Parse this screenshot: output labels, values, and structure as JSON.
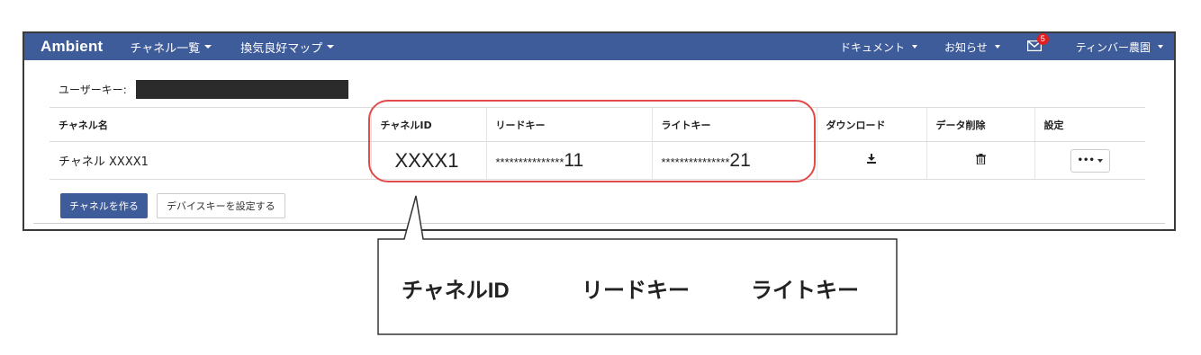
{
  "navbar": {
    "brand": "Ambient",
    "menu": [
      {
        "label": "チャネル一覧"
      },
      {
        "label": "換気良好マップ"
      }
    ],
    "documents": "ドキュメント",
    "notices": "お知らせ",
    "mail_badge": "5",
    "user": "ティンバー農園"
  },
  "userkey": {
    "label": "ユーザーキー:"
  },
  "table": {
    "headers": [
      "チャネル名",
      "チャネルID",
      "リードキー",
      "ライトキー",
      "ダウンロード",
      "データ削除",
      "設定"
    ],
    "rows": [
      {
        "name": "チャネル XXXX1",
        "channel_id": "XXXX1",
        "read_key_mask": "***************",
        "read_key_tail": "11",
        "write_key_mask": "***************",
        "write_key_tail": "21",
        "settings_label": "•••"
      }
    ]
  },
  "buttons": {
    "create_channel": "チャネルを作る",
    "device_key": "デバイスキーを設定する"
  },
  "callout": {
    "labels": [
      "チャネルID",
      "リードキー",
      "ライトキー"
    ]
  },
  "colors": {
    "navbar": "#3f5c9a",
    "highlight": "#e14b4b",
    "badge": "#e02020"
  }
}
